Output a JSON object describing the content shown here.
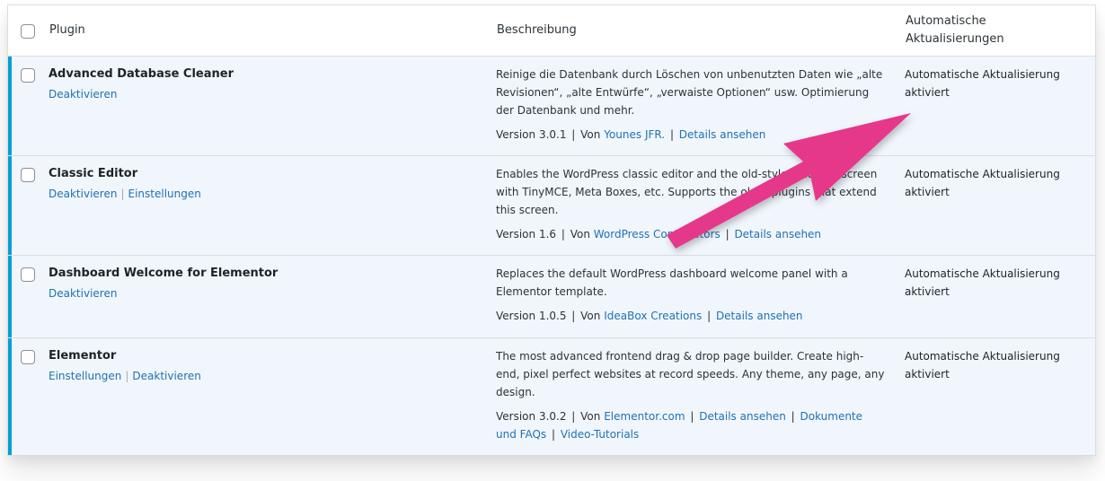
{
  "header": {
    "plugin": "Plugin",
    "description": "Beschreibung",
    "auto_updates_line1": "Automatische",
    "auto_updates_line2": "Aktualisierungen"
  },
  "colors": {
    "accent": "#00a0d2",
    "link": "#2271b1",
    "row_bg": "#f0f6fc",
    "arrow": "#e6398a"
  },
  "plugins": [
    {
      "name": "Advanced Database Cleaner",
      "actions": [
        "Deaktivieren"
      ],
      "description": "Reinige die Datenbank durch Löschen von unbenutzten Daten wie „alte Revisionen“, „alte Entwürfe“, „verwaiste Optionen“ usw. Optimierung der Datenbank und mehr.",
      "version": "Version 3.0.1",
      "by": "Von",
      "author": "Younes JFR.",
      "details": "Details ansehen",
      "auto_update_line1": "Automatische Aktualisierung",
      "auto_update_line2": "aktiviert"
    },
    {
      "name": "Classic Editor",
      "actions": [
        "Deaktivieren",
        "Einstellungen"
      ],
      "description": "Enables the WordPress classic editor and the old-style Edit Post screen with TinyMCE, Meta Boxes, etc. Supports the older plugins that extend this screen.",
      "version": "Version 1.6",
      "by": "Von",
      "author": "WordPress Contributors",
      "details": "Details ansehen",
      "auto_update_line1": "Automatische Aktualisierung",
      "auto_update_line2": "aktiviert"
    },
    {
      "name": "Dashboard Welcome for Elementor",
      "actions": [
        "Deaktivieren"
      ],
      "description": "Replaces the default WordPress dashboard welcome panel with a Elementor template.",
      "version": "Version 1.0.5",
      "by": "Von",
      "author": "IdeaBox Creations",
      "details": "Details ansehen",
      "auto_update_line1": "Automatische Aktualisierung",
      "auto_update_line2": "aktiviert"
    },
    {
      "name": "Elementor",
      "actions": [
        "Einstellungen",
        "Deaktivieren"
      ],
      "description": "The most advanced frontend drag & drop page builder. Create high-end, pixel perfect websites at record speeds. Any theme, any page, any design.",
      "version": "Version 3.0.2",
      "by": "Von",
      "author": "Elementor.com",
      "details": "Details ansehen",
      "extra_links": [
        "Dokumente und FAQs",
        "Video-Tutorials"
      ],
      "auto_update_line1": "Automatische Aktualisierung",
      "auto_update_line2": "aktiviert"
    }
  ]
}
